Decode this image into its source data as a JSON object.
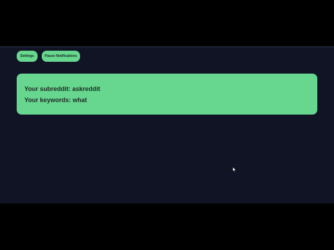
{
  "toolbar": {
    "settings_label": "Settings",
    "pause_label": "Pause Notifications"
  },
  "info": {
    "subreddit_line": "Your subreddit: askreddit",
    "keywords_line": "Your keywords: what"
  },
  "colors": {
    "background": "#111425",
    "accent": "#67d68f",
    "letterbox": "#000000"
  },
  "icons": {
    "cursor": "mouse-cursor-icon"
  }
}
